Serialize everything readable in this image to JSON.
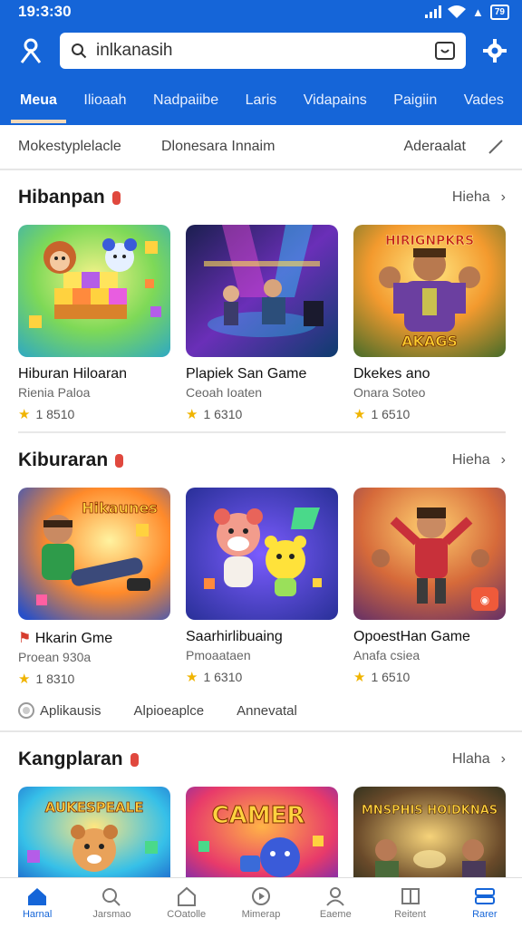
{
  "status": {
    "time": "19:3:30",
    "battery": "79"
  },
  "search": {
    "text": "inlkanasih"
  },
  "tabs": [
    {
      "label": "Meua",
      "active": true
    },
    {
      "label": "Ilioaah",
      "active": false
    },
    {
      "label": "Nadpaiibe",
      "active": false
    },
    {
      "label": "Laris",
      "active": false
    },
    {
      "label": "Vidapains",
      "active": false
    },
    {
      "label": "Paigiin",
      "active": false
    },
    {
      "label": "Vades",
      "active": false
    }
  ],
  "filter": {
    "left": "Mokestyplelacle",
    "middle": "Dlonesara Innaim",
    "right": "Aderaalat"
  },
  "sections": [
    {
      "title": "Hibanpan",
      "more": "Hieha",
      "cards": [
        {
          "title": "Hiburan Hiloaran",
          "sub": "Rienia Paloa",
          "rating": "1 8510"
        },
        {
          "title": "Plapiek San Game",
          "sub": "Ceoah Ioaten",
          "rating": "1 6310"
        },
        {
          "title": "Dkekes ano",
          "sub": "Onara Soteo",
          "rating": "1 6510"
        }
      ]
    },
    {
      "title": "Kiburaran",
      "more": "Hieha",
      "cards": [
        {
          "title": "Hkarin Gme",
          "sub": "Proean 930a",
          "rating": "1 8310"
        },
        {
          "title": "Saarhirlibuaing",
          "sub": "Pmoaataen",
          "rating": "1 6310"
        },
        {
          "title": "OpoestHan Game",
          "sub": "Anafa csiea",
          "rating": "1 6510"
        }
      ]
    },
    {
      "title": "Kangplaran",
      "more": "Hlaha",
      "cards": [
        {
          "title": "Aukespeale",
          "sub": "",
          "rating": ""
        },
        {
          "title": "Camer",
          "sub": "",
          "rating": ""
        },
        {
          "title": "Mnsphis Hoidknas",
          "sub": "",
          "rating": ""
        }
      ]
    }
  ],
  "chips": [
    "Aplikausis",
    "Alpioeaplce",
    "Annevatal"
  ],
  "banners": {
    "card1_3": "HIRIGNPKRS",
    "card1_3_b": "AKAGS",
    "card2_1": "Hikaunes",
    "card3_1": "AUKESPEALE",
    "card3_2": "CAMER",
    "card3_3": "MNSPHIS HOIDKNAS"
  },
  "nav": [
    {
      "label": "Harnal",
      "icon": "home-icon",
      "active": true
    },
    {
      "label": "Jarsmao",
      "icon": "search-icon",
      "active": false
    },
    {
      "label": "COatolle",
      "icon": "store-icon",
      "active": false
    },
    {
      "label": "Mimerap",
      "icon": "media-icon",
      "active": false
    },
    {
      "label": "Eaeme",
      "icon": "profile-icon",
      "active": false
    },
    {
      "label": "Reitent",
      "icon": "library-icon",
      "active": false
    },
    {
      "label": "Rarer",
      "icon": "menu-icon",
      "active": false
    }
  ]
}
